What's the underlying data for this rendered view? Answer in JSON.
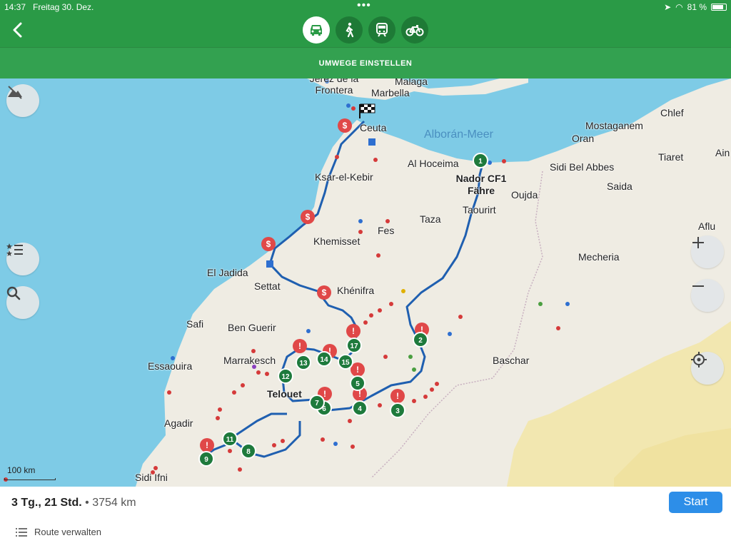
{
  "status": {
    "time": "14:37",
    "date": "Freitag 30. Dez.",
    "battery": "81 %"
  },
  "header": {
    "modes": [
      "car-icon",
      "walk-icon",
      "train-icon",
      "bike-icon"
    ],
    "active_mode": "car"
  },
  "subbar": {
    "label": "UMWEGE EINSTELLEN"
  },
  "map": {
    "sea_label": "Alborán-Meer",
    "places": [
      "Malaga",
      "Jerez de la Frontera",
      "Marbella",
      "Ceuta",
      "Ksar-el-Kebir",
      "Al Hoceima",
      "Nador CF1 Fähre",
      "Oujda",
      "Taourirt",
      "Taza",
      "Fes",
      "Khemisset",
      "Mostaganem",
      "Oran",
      "Chlef",
      "Tiaret",
      "Ain",
      "Sidi Bel Abbes",
      "Saida",
      "Aflu",
      "Mecheria",
      "El Jadida",
      "Settat",
      "Khénifra",
      "Safi",
      "Ben Guerir",
      "Marrakesch",
      "Essaouira",
      "Telouet",
      "Agadir",
      "Baschar",
      "Sidi Ifni"
    ],
    "waypoints": [
      "1",
      "2",
      "3",
      "4",
      "5",
      "6",
      "7",
      "8",
      "9",
      "11",
      "12",
      "13",
      "14",
      "15",
      "17"
    ],
    "scale": "100 km"
  },
  "summary": {
    "duration": "3 Tg., 21 Std.",
    "separator": "•",
    "distance": "3754 km"
  },
  "start_label": "Start",
  "manage_label": "Route verwalten",
  "colors": {
    "header": "#2a9a46",
    "sea": "#7ecbe6",
    "land": "#efece3",
    "route": "#1f5fb0",
    "waypoint": "#1e7a3c",
    "warning": "#e04848",
    "start_button": "#2d8ee8"
  }
}
